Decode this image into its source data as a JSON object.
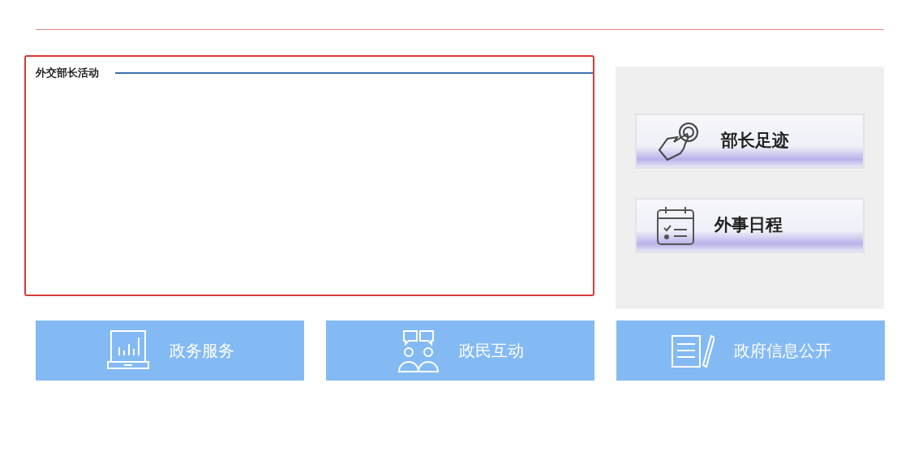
{
  "activity_panel": {
    "title": "外交部长活动"
  },
  "quick_links": [
    {
      "label": "部长足迹",
      "kind": "hand"
    },
    {
      "label": "外事日程",
      "kind": "calendar"
    }
  ],
  "service_tiles": [
    {
      "label": "政务服务",
      "kind": "chart"
    },
    {
      "label": "政民互动",
      "kind": "people"
    },
    {
      "label": "政府信息公开",
      "kind": "document"
    }
  ]
}
